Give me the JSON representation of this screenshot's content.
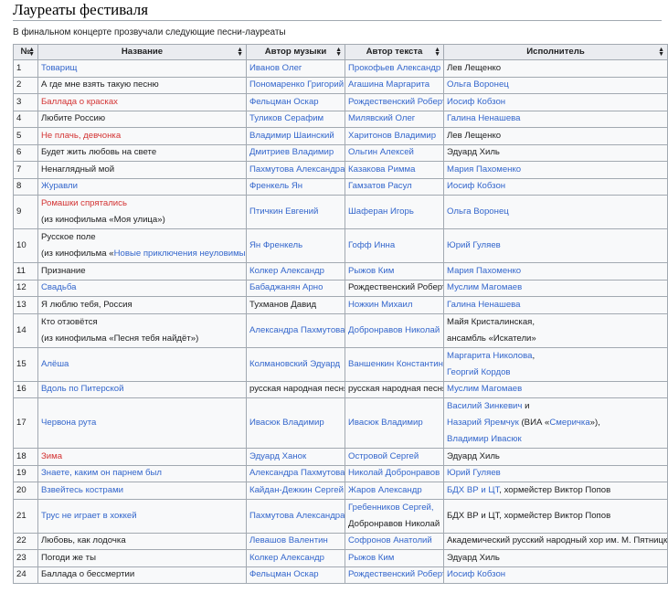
{
  "heading": "Лауреаты фестиваля",
  "intro": "В финальном концерте прозвучали следующие песни-лауреаты",
  "columns": [
    "№",
    "Название",
    "Автор музыки",
    "Автор текста",
    "Исполнитель"
  ],
  "sort_icon": "sort-arrows-icon",
  "colors": {
    "link": "#3366cc",
    "redlink": "#d33333",
    "text": "#202122",
    "header_bg": "#eaecf0",
    "border": "#a2a9b1"
  },
  "rows": [
    {
      "n": "1",
      "title": "Товарищ",
      "music": "Иванов Олег",
      "lyrics": "Прокофьев Александр",
      "perf": "Лев Лещенко"
    },
    {
      "n": "2",
      "title": "А где мне взять такую песню",
      "music": "Пономаренко Григорий",
      "lyrics": "Агашина Маргарита",
      "perf": "Ольга Воронец"
    },
    {
      "n": "3",
      "title": "Баллада о красках",
      "music": "Фельцман Оскар",
      "lyrics": "Рождественский Роберт",
      "perf": "Иосиф Кобзон"
    },
    {
      "n": "4",
      "title": "Любите Россию",
      "music": "Туликов Серафим",
      "lyrics": "Милявский Олег",
      "perf": "Галина Ненашева"
    },
    {
      "n": "5",
      "title": "Не плачь, девчонка",
      "music": "Владимир Шаинский",
      "lyrics": "Харитонов Владимир",
      "perf": "Лев Лещенко"
    },
    {
      "n": "6",
      "title": "Будет жить любовь на свете",
      "music": "Дмитриев Владимир",
      "lyrics": "Ольгин Алексей",
      "perf": "Эдуард Хиль"
    },
    {
      "n": "7",
      "title": "Ненаглядный мой",
      "music": "Пахмутова Александра",
      "lyrics": "Казакова Римма",
      "perf": "Мария Пахоменко"
    },
    {
      "n": "8",
      "title": "Журавли",
      "music": "Френкель Ян",
      "lyrics": "Гамзатов Расул",
      "perf": "Иосиф Кобзон"
    },
    {
      "n": "9",
      "title": "Ромашки спрятались",
      "title2": "(из кинофильма «Моя улица»)",
      "music": "Птичкин Евгений",
      "lyrics": "Шаферан Игорь",
      "perf": "Ольга Воронец"
    },
    {
      "n": "10",
      "title": "Русское поле",
      "title2a": "(из кинофильма «",
      "title2b": "Новые приключения неуловимых",
      "title2c": "»)",
      "music": "Ян Френкель",
      "lyrics": "Гофф Инна",
      "perf": "Юрий Гуляев"
    },
    {
      "n": "11",
      "title": "Признание",
      "music": "Колкер Александр",
      "lyrics": "Рыжов Ким",
      "perf": "Мария Пахоменко"
    },
    {
      "n": "12",
      "title": "Свадьба",
      "music": "Бабаджанян Арно",
      "lyrics": "Рождественский Роберт",
      "perf": "Муслим Магомаев"
    },
    {
      "n": "13",
      "title": "Я люблю тебя, Россия",
      "music": "Тухманов Давид",
      "lyrics": "Ножкин Михаил",
      "perf": "Галина Ненашева"
    },
    {
      "n": "14",
      "title": "Кто отзовётся",
      "title2": "(из кинофильма «Песня тебя найдёт»)",
      "music": "Александра Пахмутова",
      "lyrics": "Добронравов Николай",
      "perf": "Майя Кристалинская",
      "perf_sep": ",",
      "perf2": "ансамбль «Искатели»"
    },
    {
      "n": "15",
      "title": "Алёша",
      "music": "Колмановский Эдуард",
      "lyrics": "Ваншенкин Константин",
      "perf": "Маргарита Николова",
      "perf_sep": ",",
      "perf2": "Георгий Кордов"
    },
    {
      "n": "16",
      "title": "Вдоль по Питерской",
      "music": "русская народная песня",
      "lyrics": "русская народная песня",
      "perf": "Муслим Магомаев"
    },
    {
      "n": "17",
      "title": "Червона рута",
      "music": "Ивасюк Владимир",
      "lyrics": "Ивасюк Владимир",
      "perf": "Василий Зинкевич",
      "perf_sep": " и",
      "perf2a": "Назарий Яремчук",
      "perf2b": " (ВИА «",
      "perf2c": "Смеричка",
      "perf2d": "»),",
      "perf3": "Владимир Ивасюк"
    },
    {
      "n": "18",
      "title": "Зима",
      "music": "Эдуард Ханок",
      "lyrics": "Островой Сергей",
      "perf": "Эдуард Хиль"
    },
    {
      "n": "19",
      "title": "Знаете, каким он парнем был",
      "music": "Александра Пахмутова",
      "lyrics": "Николай Добронравов",
      "perf": "Юрий Гуляев"
    },
    {
      "n": "20",
      "title": "Взвейтесь кострами",
      "music": "Кайдан-Дежкин Сергей",
      "lyrics": "Жаров Александр",
      "perf_a": "БДХ ВР и ЦТ",
      "perf_b": ", хормейстер Виктор Попов"
    },
    {
      "n": "21",
      "title": "Трус не играет в хоккей",
      "music": "Пахмутова Александра",
      "lyrics": "Гребенников Сергей,",
      "lyrics2": "Добронравов Николай",
      "perf_b": "БДХ ВР и ЦТ, хормейстер Виктор Попов"
    },
    {
      "n": "22",
      "title": "Любовь, как лодочка",
      "music": "Левашов Валентин",
      "lyrics": "Софронов Анатолий",
      "perf_b": "Академический русский народный хор им. М. Пятницкого"
    },
    {
      "n": "23",
      "title": "Погоди же ты",
      "music": "Колкер Александр",
      "lyrics": "Рыжов Ким",
      "perf": "Эдуард Хиль"
    },
    {
      "n": "24",
      "title": "Баллада о бессмертии",
      "music": "Фельцман Оскар",
      "lyrics": "Рождественский Роберт",
      "perf": "Иосиф Кобзон"
    }
  ]
}
